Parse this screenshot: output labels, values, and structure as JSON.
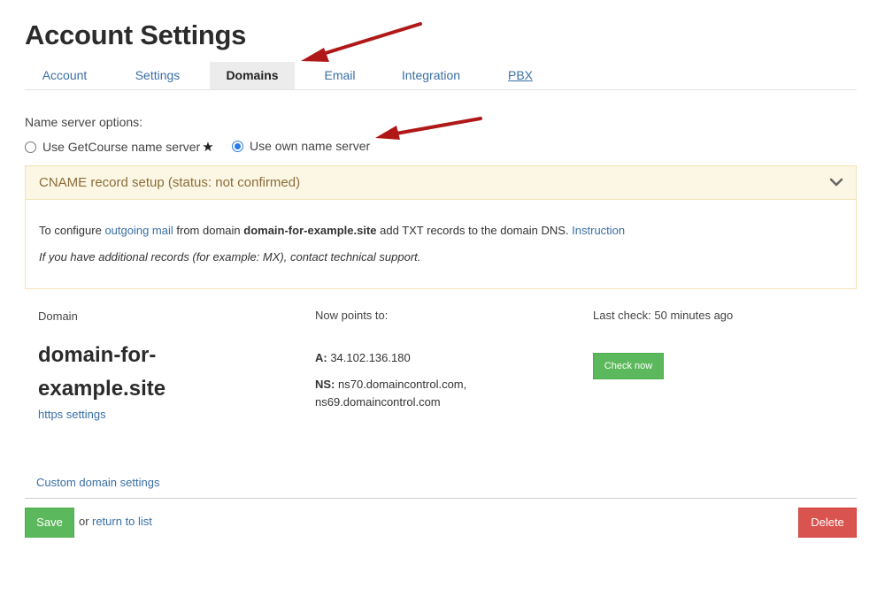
{
  "page": {
    "title": "Account Settings"
  },
  "tabs": [
    {
      "label": "Account",
      "active": false
    },
    {
      "label": "Settings",
      "active": false
    },
    {
      "label": "Domains",
      "active": true
    },
    {
      "label": "Email",
      "active": false
    },
    {
      "label": "Integration",
      "active": false
    },
    {
      "label": "PBX",
      "active": false
    }
  ],
  "name_server": {
    "label": "Name server options:",
    "options": [
      {
        "label": "Use GetCourse name server",
        "suffix": "★",
        "checked": false
      },
      {
        "label": "Use own name server",
        "checked": true
      }
    ]
  },
  "cname": {
    "title": "CNAME record setup (status: not confirmed)",
    "line1_prefix": "To configure ",
    "line1_link": "outgoing mail",
    "line1_mid": " from domain ",
    "line1_domain": "domain-for-example.site",
    "line1_suffix": " add TXT records to the domain DNS. ",
    "line1_link2": "Instruction",
    "line2": "If you have additional records (for example: MX), contact technical support."
  },
  "domain": {
    "label": "Domain",
    "name_line1": "domain-for-",
    "name_line2": "example.site",
    "https_link": "https settings"
  },
  "points": {
    "label": "Now points to:",
    "a_label": "A:",
    "a_value": " 34.102.136.180",
    "ns_label": "NS:",
    "ns_value1": " ns70.domaincontrol.com,",
    "ns_value2": "ns69.domaincontrol.com"
  },
  "last_check": {
    "label": "Last check: 50 minutes ago",
    "button": "Check now"
  },
  "footer": {
    "custom_link": "Custom domain settings",
    "save": "Save",
    "or": "or",
    "return": "return to list",
    "delete": "Delete"
  },
  "colors": {
    "accent_link": "#3a6fa6",
    "success": "#5cb85c",
    "danger": "#d9534f",
    "warning_bg": "#fcf7e4",
    "annotation_arrow": "#b01818"
  },
  "icons": {
    "chevron": "chevron-down-icon",
    "arrow": "red-annotation-arrow"
  }
}
